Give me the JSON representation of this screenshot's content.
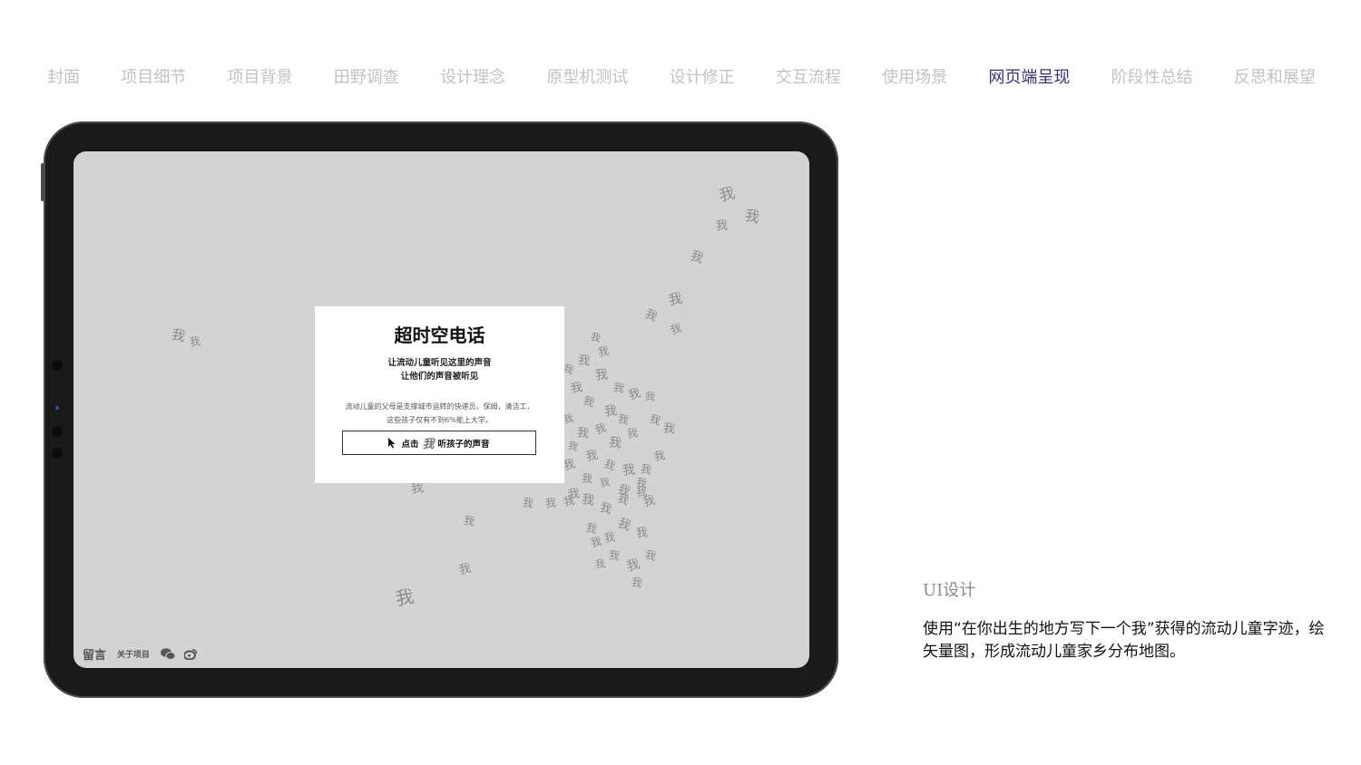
{
  "nav": {
    "items": [
      {
        "label": "封面"
      },
      {
        "label": "项目细节"
      },
      {
        "label": "项目背景"
      },
      {
        "label": "田野调查"
      },
      {
        "label": "设计理念"
      },
      {
        "label": "原型机测试"
      },
      {
        "label": "设计修正"
      },
      {
        "label": "交互流程"
      },
      {
        "label": "使用场景"
      },
      {
        "label": "网页端呈现",
        "active": true
      },
      {
        "label": "阶段性总结"
      },
      {
        "label": "反思和展望"
      }
    ],
    "active_color": "#3b2f7a",
    "inactive_color": "#c2c2c2"
  },
  "screen": {
    "background": "#d3d3d3",
    "map_glyph": "我",
    "modal": {
      "title": "超时空电话",
      "subtitle_line1": "让流动儿童听见这里的声音",
      "subtitle_line2": "让他们的声音被听见",
      "desc_line1": "流动儿童的父母是支撑城市运转的快递员，保姆，清洁工，",
      "desc_line2": "这些孩子仅有不到6%能上大学。",
      "button_left": "点击",
      "button_glyph": "我",
      "button_right": "听孩子的声音"
    },
    "footer": {
      "message": "留言",
      "about": "关于项目",
      "icons": [
        "wechat-icon",
        "weibo-icon"
      ]
    }
  },
  "caption": {
    "title": "UI设计",
    "text": "使用“在你出生的地方写下一个我”获得的流动儿童字迹，绘矢量图，形成流动儿童家乡分布地图。"
  }
}
